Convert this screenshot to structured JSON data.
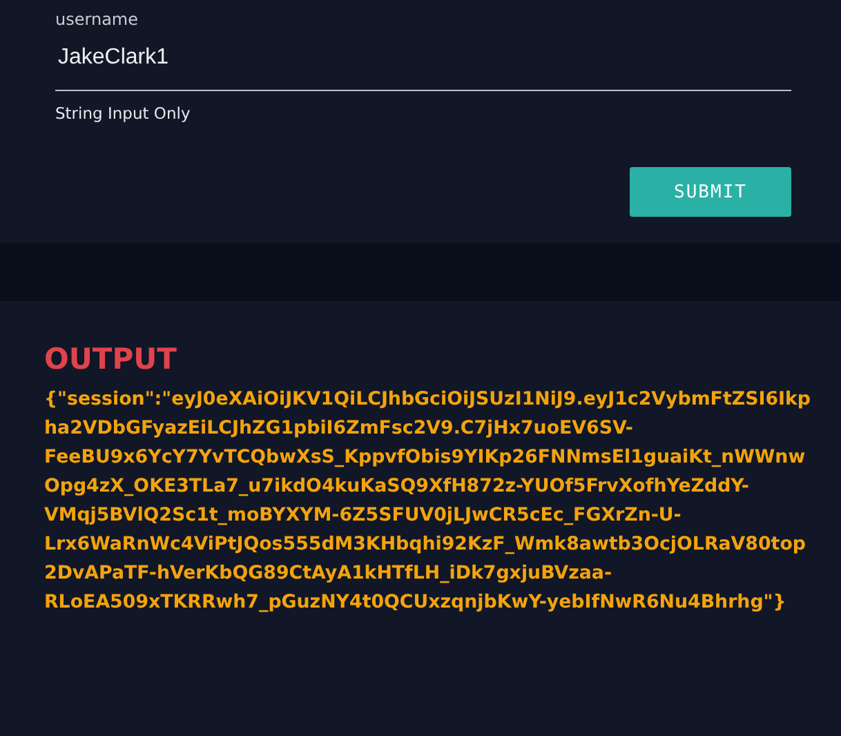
{
  "form": {
    "field": {
      "label": "username",
      "value": "JakeClark1",
      "helper": "String Input Only"
    },
    "submit": "SUBMIT"
  },
  "output": {
    "heading": "OUTPUT",
    "text": "{\"session\":\"eyJ0eXAiOiJKV1QiLCJhbGciOiJSUzI1NiJ9.eyJ1c2VybmFtZSI6Ikpha2VDbGFyazEiLCJhZG1pbiI6ZmFsc2V9.C7jHx7uoEV6SV-FeeBU9x6YcY7YvTCQbwXsS_KppvfObis9YIKp26FNNmsEl1guaiKt_nWWnwOpg4zX_OKE3TLa7_u7ikdO4kuKaSQ9XfH872z-YUOf5FrvXofhYeZddY-VMqj5BVlQ2Sc1t_moBYXYM-6Z5SFUV0jLJwCR5cEc_FGXrZn-U-Lrx6WaRnWc4ViPtJQos555dM3KHbqhi92KzF_Wmk8awtb3OcjOLRaV80top2DvAPaTF-hVerKbQG89CtAyA1kHTfLH_iDk7gxjuBVzaa-RLoEA509xTKRRwh7_pGuzNY4t0QCUxzqnjbKwY-yebIfNwR6Nu4Bhrhg\"}"
  }
}
